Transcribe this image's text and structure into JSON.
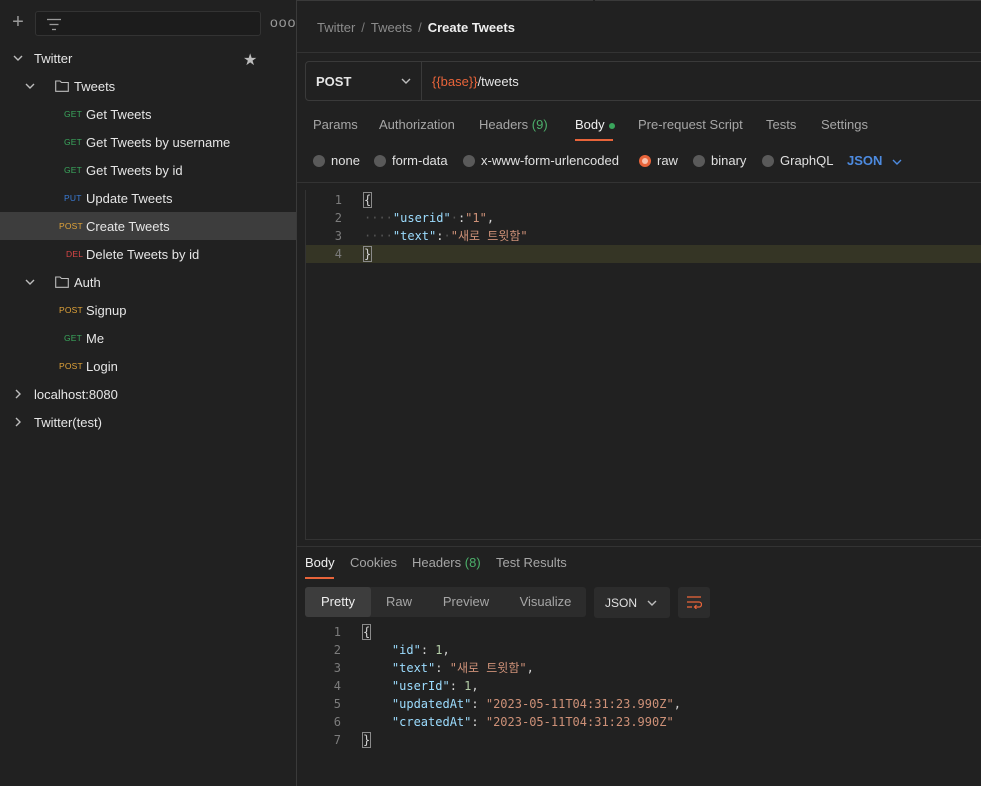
{
  "sidebar": {
    "tree": [
      {
        "kind": "collection",
        "label": "Twitter",
        "expanded": true,
        "starred": true
      },
      {
        "kind": "folder",
        "label": "Tweets",
        "expanded": true
      },
      {
        "kind": "request",
        "method": "GET",
        "label": "Get Tweets"
      },
      {
        "kind": "request",
        "method": "GET",
        "label": "Get Tweets by username"
      },
      {
        "kind": "request",
        "method": "GET",
        "label": "Get Tweets by id"
      },
      {
        "kind": "request",
        "method": "PUT",
        "label": "Update Tweets"
      },
      {
        "kind": "request",
        "method": "POST",
        "label": "Create Tweets",
        "selected": true
      },
      {
        "kind": "request",
        "method": "DEL",
        "label": "Delete Tweets by id"
      },
      {
        "kind": "folder",
        "label": "Auth",
        "expanded": true
      },
      {
        "kind": "request",
        "method": "POST",
        "label": "Signup"
      },
      {
        "kind": "request",
        "method": "GET",
        "label": "Me"
      },
      {
        "kind": "request",
        "method": "POST",
        "label": "Login"
      },
      {
        "kind": "collection",
        "label": "localhost:8080",
        "expanded": false
      },
      {
        "kind": "collection",
        "label": "Twitter(test)",
        "expanded": false
      }
    ],
    "more_label": "ooo"
  },
  "breadcrumb": {
    "items": [
      "Twitter",
      "Tweets"
    ],
    "current": "Create Tweets",
    "separator": "/"
  },
  "request": {
    "method": "POST",
    "url_var": "{{base}}",
    "url_path": "/tweets"
  },
  "req_tabs": {
    "params": "Params",
    "authorization": "Authorization",
    "headers": "Headers",
    "headers_count": "(9)",
    "body": "Body",
    "prerequest": "Pre-request Script",
    "tests": "Tests",
    "settings": "Settings"
  },
  "body_modes": {
    "none": "none",
    "form_data": "form-data",
    "urlencoded": "x-www-form-urlencoded",
    "raw": "raw",
    "binary": "binary",
    "graphql": "GraphQL",
    "language": "JSON",
    "selected": "raw"
  },
  "request_body": {
    "line_numbers": [
      "1",
      "2",
      "3",
      "4"
    ],
    "open": "{",
    "k1": "\"userid\"",
    "v1": "\"1\"",
    "k2": "\"text\"",
    "v2": "\"새로 트윗함\"",
    "close": "}"
  },
  "resp_tabs": {
    "body": "Body",
    "cookies": "Cookies",
    "headers": "Headers",
    "headers_count": "(8)",
    "test_results": "Test Results"
  },
  "resp_view": {
    "pretty": "Pretty",
    "raw": "Raw",
    "preview": "Preview",
    "visualize": "Visualize",
    "format": "JSON"
  },
  "response_body": {
    "line_numbers": [
      "1",
      "2",
      "3",
      "4",
      "5",
      "6",
      "7"
    ],
    "open": "{",
    "k_id": "\"id\"",
    "v_id": "1",
    "k_text": "\"text\"",
    "v_text": "\"새로 트윗함\"",
    "k_userId": "\"userId\"",
    "v_userId": "1",
    "k_updatedAt": "\"updatedAt\"",
    "v_updatedAt": "\"2023-05-11T04:31:23.990Z\"",
    "k_createdAt": "\"createdAt\"",
    "v_createdAt": "\"2023-05-11T04:31:23.990Z\"",
    "close": "}"
  },
  "colors": {
    "accent": "#e8643a",
    "get": "#3aa55c",
    "post": "#e0a339",
    "put": "#3a7bd5",
    "delete": "#d64545",
    "count_green": "#4caf6a",
    "json_blue": "#4d8be0"
  },
  "icons": [
    "plus-icon",
    "filter-icon",
    "more-icon",
    "chevron-down-icon",
    "chevron-right-icon",
    "folder-icon",
    "star-icon",
    "wrap-icon"
  ]
}
